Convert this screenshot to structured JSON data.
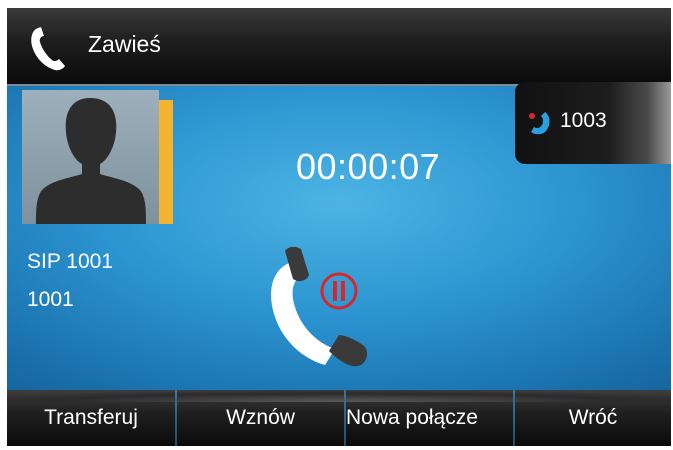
{
  "header": {
    "title": "Zawieś",
    "icon": "handset-icon"
  },
  "caller": {
    "name": "SIP 1001",
    "number": "1001",
    "avatar_icon": "person-silhouette-icon"
  },
  "call": {
    "timer": "00:00:07",
    "status_icon": "pause-icon",
    "status_color": "#d9262c"
  },
  "line": {
    "number": "1003",
    "icon": "line-phone-icon",
    "icon_color": "#2aa0e0"
  },
  "softkeys": [
    {
      "label": "Transferuj"
    },
    {
      "label": "Wznów"
    },
    {
      "label": "Nowa połącze"
    },
    {
      "label": "Wróć"
    }
  ],
  "colors": {
    "accent_tab": "#f5b42f",
    "screen_blue": "#2a92cf"
  }
}
